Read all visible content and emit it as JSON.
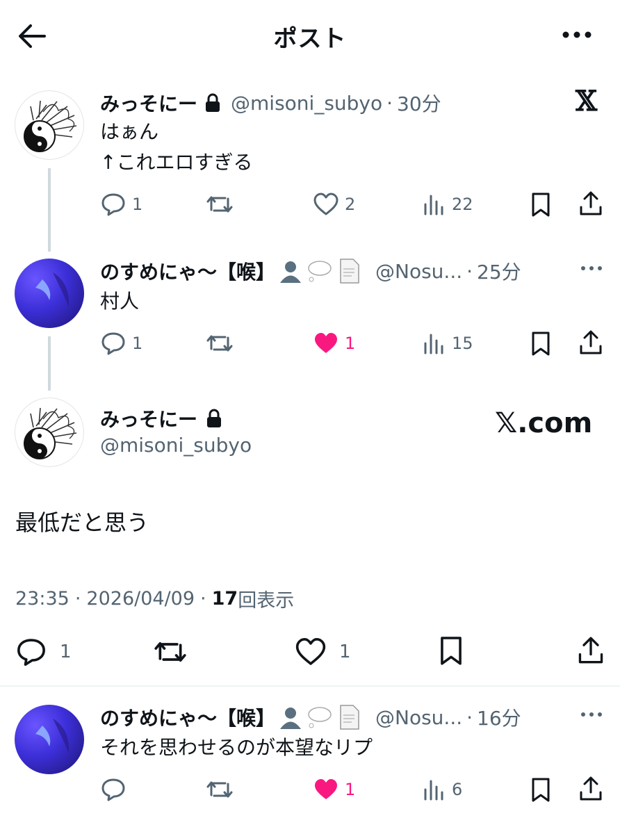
{
  "header": {
    "title": "ポスト"
  },
  "post1": {
    "name": "みっそにー",
    "handle": "@misoni_subyo",
    "time": "30分",
    "lines": [
      "はぁん",
      "↑これエロすぎる"
    ],
    "replies": "1",
    "likes": "2",
    "views": "22",
    "brand": "𝕏"
  },
  "post2": {
    "name": "のすめにゃ〜【喉】",
    "handle": "@Nosu...",
    "time": "25分",
    "text": "村人",
    "replies": "1",
    "likes": "1",
    "views": "15"
  },
  "main": {
    "name": "みっそにー",
    "handle": "@misoni_subyo",
    "brand": "𝕏.com",
    "text": "最低だと思う",
    "time": "23:35",
    "date": "2026/04/09",
    "views_count": "17",
    "views_label": "回表示",
    "replies": "1",
    "likes": "1"
  },
  "post3": {
    "name": "のすめにゃ〜【喉】",
    "handle": "@Nosu...",
    "time": "16分",
    "text": "それを思わせるのが本望なリプ",
    "likes": "1",
    "views": "6"
  },
  "colors": {
    "like_pink": "#f91880",
    "secondary": "#536471",
    "thread_line": "#cfd9de"
  },
  "icons": [
    "back-arrow-icon",
    "more-icon",
    "lock-icon",
    "reply-icon",
    "retweet-icon",
    "heart-icon",
    "views-icon",
    "bookmark-icon",
    "share-icon"
  ]
}
